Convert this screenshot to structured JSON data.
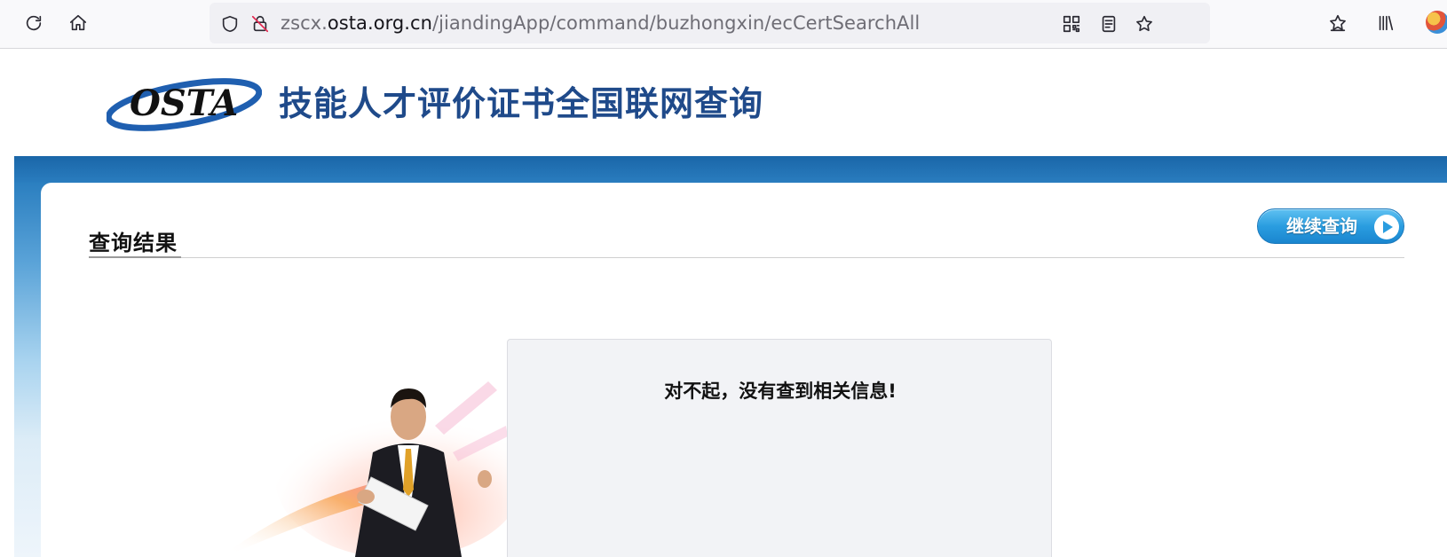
{
  "browser": {
    "url_prefix": "zscx.",
    "url_host": "osta.org.cn",
    "url_path": "/jiandingApp/command/buzhongxin/ecCertSearchAll",
    "icons": [
      "reload-icon",
      "home-icon",
      "shield-icon",
      "insecure-lock-icon",
      "qr-code-icon",
      "reader-view-icon",
      "bookmark-star-icon",
      "bookmarks-menu-icon",
      "library-icon",
      "extension-avatar-icon"
    ]
  },
  "header": {
    "logo_text": "OSTA",
    "site_title": "技能人才评价证书全国联网查询"
  },
  "results": {
    "heading": "查询结果",
    "continue_label": "继续查询",
    "message": "对不起，没有查到相关信息!"
  },
  "colors": {
    "brand_blue": "#1f4a8a",
    "band_blue": "#1f6fb2",
    "button_blue": "#2a9de0"
  }
}
